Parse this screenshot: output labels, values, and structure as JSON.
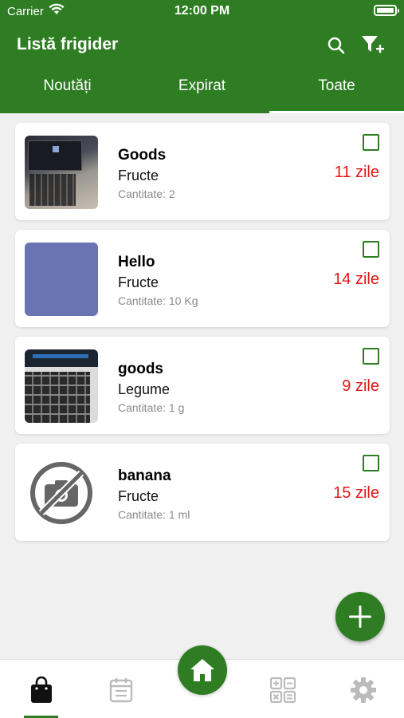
{
  "statusbar": {
    "carrier": "Carrier",
    "time": "12:00 PM"
  },
  "header": {
    "title": "Listă frigider"
  },
  "tabs": [
    {
      "label": "Noutăți",
      "active": false
    },
    {
      "label": "Expirat",
      "active": false
    },
    {
      "label": "Toate",
      "active": true
    }
  ],
  "items": [
    {
      "name": "Goods",
      "category": "Fructe",
      "qty_label": "Cantitate: 2",
      "qty_unit": "",
      "days": "11 zile",
      "image": "laptop-photo",
      "checked": false
    },
    {
      "name": "Hello",
      "category": "Fructe",
      "qty_label": "Cantitate: 10",
      "qty_unit": "Kg",
      "days": "14 zile",
      "image": "blue-photo",
      "checked": false
    },
    {
      "name": "goods",
      "category": "Legume",
      "qty_label": "Cantitate: 1",
      "qty_unit": "g",
      "days": "9 zile",
      "image": "keyboard-photo",
      "checked": false
    },
    {
      "name": "banana",
      "category": "Fructe",
      "qty_label": "Cantitate: 1",
      "qty_unit": "ml",
      "days": "15 zile",
      "image": "no-photo-icon",
      "checked": false
    }
  ],
  "colors": {
    "primary": "#2e7d23",
    "expiry": "#e01818",
    "background": "#f0f0f0"
  },
  "tabbar": {
    "items": [
      "shopping-bag-icon",
      "calendar-list-icon",
      "home-icon",
      "calculator-icon",
      "settings-gear-icon"
    ],
    "active": "shopping-bag-icon"
  }
}
